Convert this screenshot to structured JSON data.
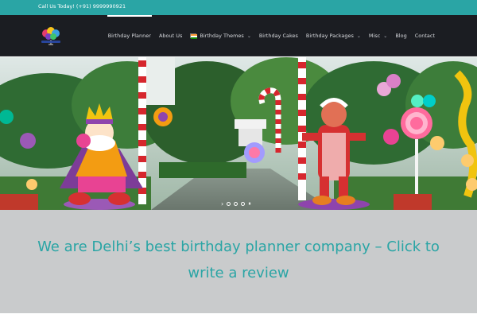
{
  "topbar": {
    "call_text": "Call Us Today! (+91) 9999990921"
  },
  "nav": {
    "items": [
      {
        "label": "Birthday Planner",
        "active": true,
        "dropdown": false
      },
      {
        "label": "About Us",
        "active": false,
        "dropdown": false
      },
      {
        "label": "Birthday Themes",
        "active": false,
        "dropdown": true
      },
      {
        "label": "Birthday Cakes",
        "active": false,
        "dropdown": false
      },
      {
        "label": "Birthday Packages",
        "active": false,
        "dropdown": true
      },
      {
        "label": "Misc",
        "active": false,
        "dropdown": true
      },
      {
        "label": "Blog",
        "active": false,
        "dropdown": false
      },
      {
        "label": "Contact",
        "active": false,
        "dropdown": false
      }
    ]
  },
  "slider": {
    "arrow": "›",
    "pause": "⏸",
    "dot_count": 3
  },
  "cta": {
    "text": "We are Delhi’s best birthday planner company – Click to write a review"
  },
  "colors": {
    "accent": "#2aa5a5",
    "nav_bg": "#1b1d22",
    "cta_bg": "#c9cbcc"
  }
}
